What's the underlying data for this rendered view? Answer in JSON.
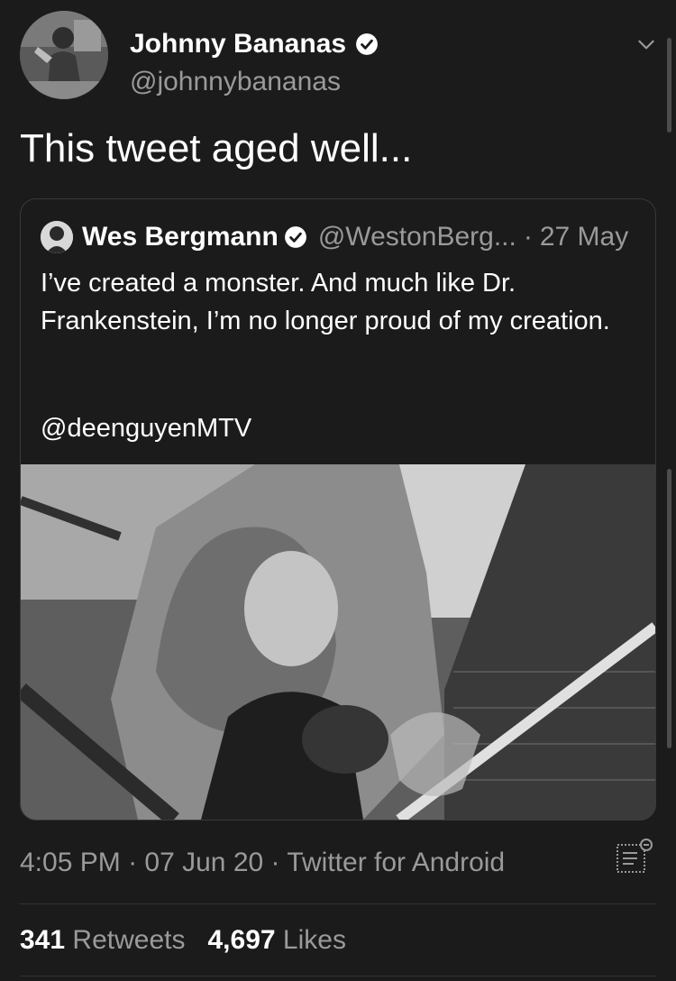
{
  "author": {
    "display_name": "Johnny Bananas",
    "handle": "@johnnybananas",
    "verified_icon": "verified-badge-icon"
  },
  "tweet": {
    "text": "This tweet aged well..."
  },
  "quote": {
    "display_name": "Wes Bergmann",
    "handle": "@WestonBerg...",
    "separator": "·",
    "date": "27 May",
    "text": "I’ve created a monster. And much like Dr. Frankenstein, I’m no longer proud of my creation.",
    "mention": "@deenguyenMTV"
  },
  "meta": {
    "time": "4:05 PM",
    "date": "07 Jun 20",
    "source": "Twitter for Android",
    "separator": "·"
  },
  "stats": {
    "retweets_count": "341",
    "retweets_label": "Retweets",
    "likes_count": "4,697",
    "likes_label": "Likes"
  },
  "colors": {
    "background": "#1b1b1b",
    "text_primary": "#ffffff",
    "text_secondary": "#9a9a9a"
  }
}
